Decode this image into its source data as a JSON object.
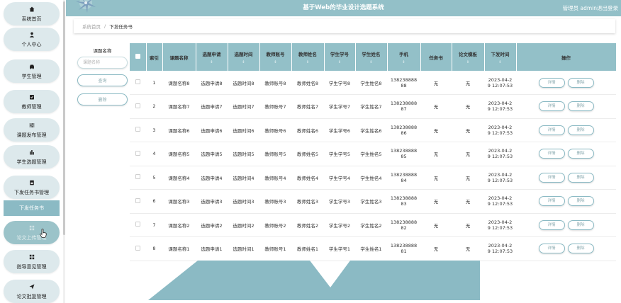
{
  "sidebar": {
    "items": [
      {
        "label": "系统首页",
        "icon": "home-icon"
      },
      {
        "label": "个人中心",
        "icon": "user-icon"
      },
      {
        "label": "学生管理",
        "icon": "car-icon"
      },
      {
        "label": "教师管理",
        "icon": "clipboard-icon"
      },
      {
        "label": "课题发布管理",
        "icon": "sliders-icon"
      },
      {
        "label": "学生选题管理",
        "icon": "chart-icon"
      },
      {
        "label": "下发任务书管理",
        "icon": "document-icon"
      },
      {
        "label": "论文上传管理",
        "icon": "grid-icon"
      },
      {
        "label": "指导意见管理",
        "icon": "grid-icon"
      },
      {
        "label": "论文批复管理",
        "icon": "send-icon"
      }
    ],
    "sub_item": "下发任务书"
  },
  "header": {
    "title": "基于Web的毕业设计选题系统",
    "user": "管理员 admin",
    "logout": "退出登录"
  },
  "breadcrumb": {
    "home": "系统首页",
    "separator": "/",
    "current": "下发任务书"
  },
  "search": {
    "label": "课题名称",
    "placeholder": "课题名称",
    "query_button": "查询",
    "delete_button": "删除"
  },
  "table": {
    "columns": [
      "索引",
      "课题名称",
      "选题申请",
      "选题时间",
      "教师账号",
      "教师姓名",
      "学生学号",
      "学生姓名",
      "手机",
      "任务书",
      "论文模板",
      "下发时间",
      "操作"
    ],
    "sort_glyph": "⇕",
    "detail_label": "详情",
    "delete_label": "删除",
    "rows": [
      {
        "index": "1",
        "topic": "课题名称8",
        "apply": "选题申请8",
        "time": "选题时间8",
        "teacher_account": "教师账号8",
        "teacher_name": "教师姓名8",
        "student_id": "学生学号8",
        "student_name": "学生姓名8",
        "phone_a": "138238888",
        "phone_b": "88",
        "task_book": "无",
        "template": "无",
        "issue_a": "2023-04-2",
        "issue_b": "9 12:07:53"
      },
      {
        "index": "2",
        "topic": "课题名称7",
        "apply": "选题申请7",
        "time": "选题时间7",
        "teacher_account": "教师账号7",
        "teacher_name": "教师姓名7",
        "student_id": "学生学号7",
        "student_name": "学生姓名7",
        "phone_a": "138238888",
        "phone_b": "87",
        "task_book": "无",
        "template": "无",
        "issue_a": "2023-04-2",
        "issue_b": "9 12:07:53"
      },
      {
        "index": "3",
        "topic": "课题名称6",
        "apply": "选题申请6",
        "time": "选题时间6",
        "teacher_account": "教师账号6",
        "teacher_name": "教师姓名6",
        "student_id": "学生学号6",
        "student_name": "学生姓名6",
        "phone_a": "138238888",
        "phone_b": "86",
        "task_book": "无",
        "template": "无",
        "issue_a": "2023-04-2",
        "issue_b": "9 12:07:53"
      },
      {
        "index": "4",
        "topic": "课题名称5",
        "apply": "选题申请5",
        "time": "选题时间5",
        "teacher_account": "教师账号5",
        "teacher_name": "教师姓名5",
        "student_id": "学生学号5",
        "student_name": "学生姓名5",
        "phone_a": "138238888",
        "phone_b": "85",
        "task_book": "无",
        "template": "无",
        "issue_a": "2023-04-2",
        "issue_b": "9 12:07:53"
      },
      {
        "index": "5",
        "topic": "课题名称4",
        "apply": "选题申请4",
        "time": "选题时间4",
        "teacher_account": "教师账号4",
        "teacher_name": "教师姓名4",
        "student_id": "学生学号4",
        "student_name": "学生姓名4",
        "phone_a": "138238888",
        "phone_b": "84",
        "task_book": "无",
        "template": "无",
        "issue_a": "2023-04-2",
        "issue_b": "9 12:07:53"
      },
      {
        "index": "6",
        "topic": "课题名称3",
        "apply": "选题申请3",
        "time": "选题时间3",
        "teacher_account": "教师账号3",
        "teacher_name": "教师姓名3",
        "student_id": "学生学号3",
        "student_name": "学生姓名3",
        "phone_a": "138238888",
        "phone_b": "83",
        "task_book": "无",
        "template": "无",
        "issue_a": "2023-04-2",
        "issue_b": "9 12:07:53"
      },
      {
        "index": "7",
        "topic": "课题名称2",
        "apply": "选题申请2",
        "time": "选题时间2",
        "teacher_account": "教师账号2",
        "teacher_name": "教师姓名2",
        "student_id": "学生学号2",
        "student_name": "学生姓名2",
        "phone_a": "138238888",
        "phone_b": "82",
        "task_book": "无",
        "template": "无",
        "issue_a": "2023-04-2",
        "issue_b": "9 12:07:53"
      },
      {
        "index": "8",
        "topic": "课题名称1",
        "apply": "选题申请1",
        "time": "选题时间1",
        "teacher_account": "教师账号1",
        "teacher_name": "教师姓名1",
        "student_id": "学生学号1",
        "student_name": "学生姓名1",
        "phone_a": "138238888",
        "phone_b": "81",
        "task_book": "无",
        "template": "无",
        "issue_a": "2023-04-2",
        "issue_b": "9 12:07:53"
      }
    ]
  },
  "colors": {
    "accent": "#93c0c8",
    "accent_dark": "#8bbac4",
    "sidebar_item": "#dde9ec"
  }
}
